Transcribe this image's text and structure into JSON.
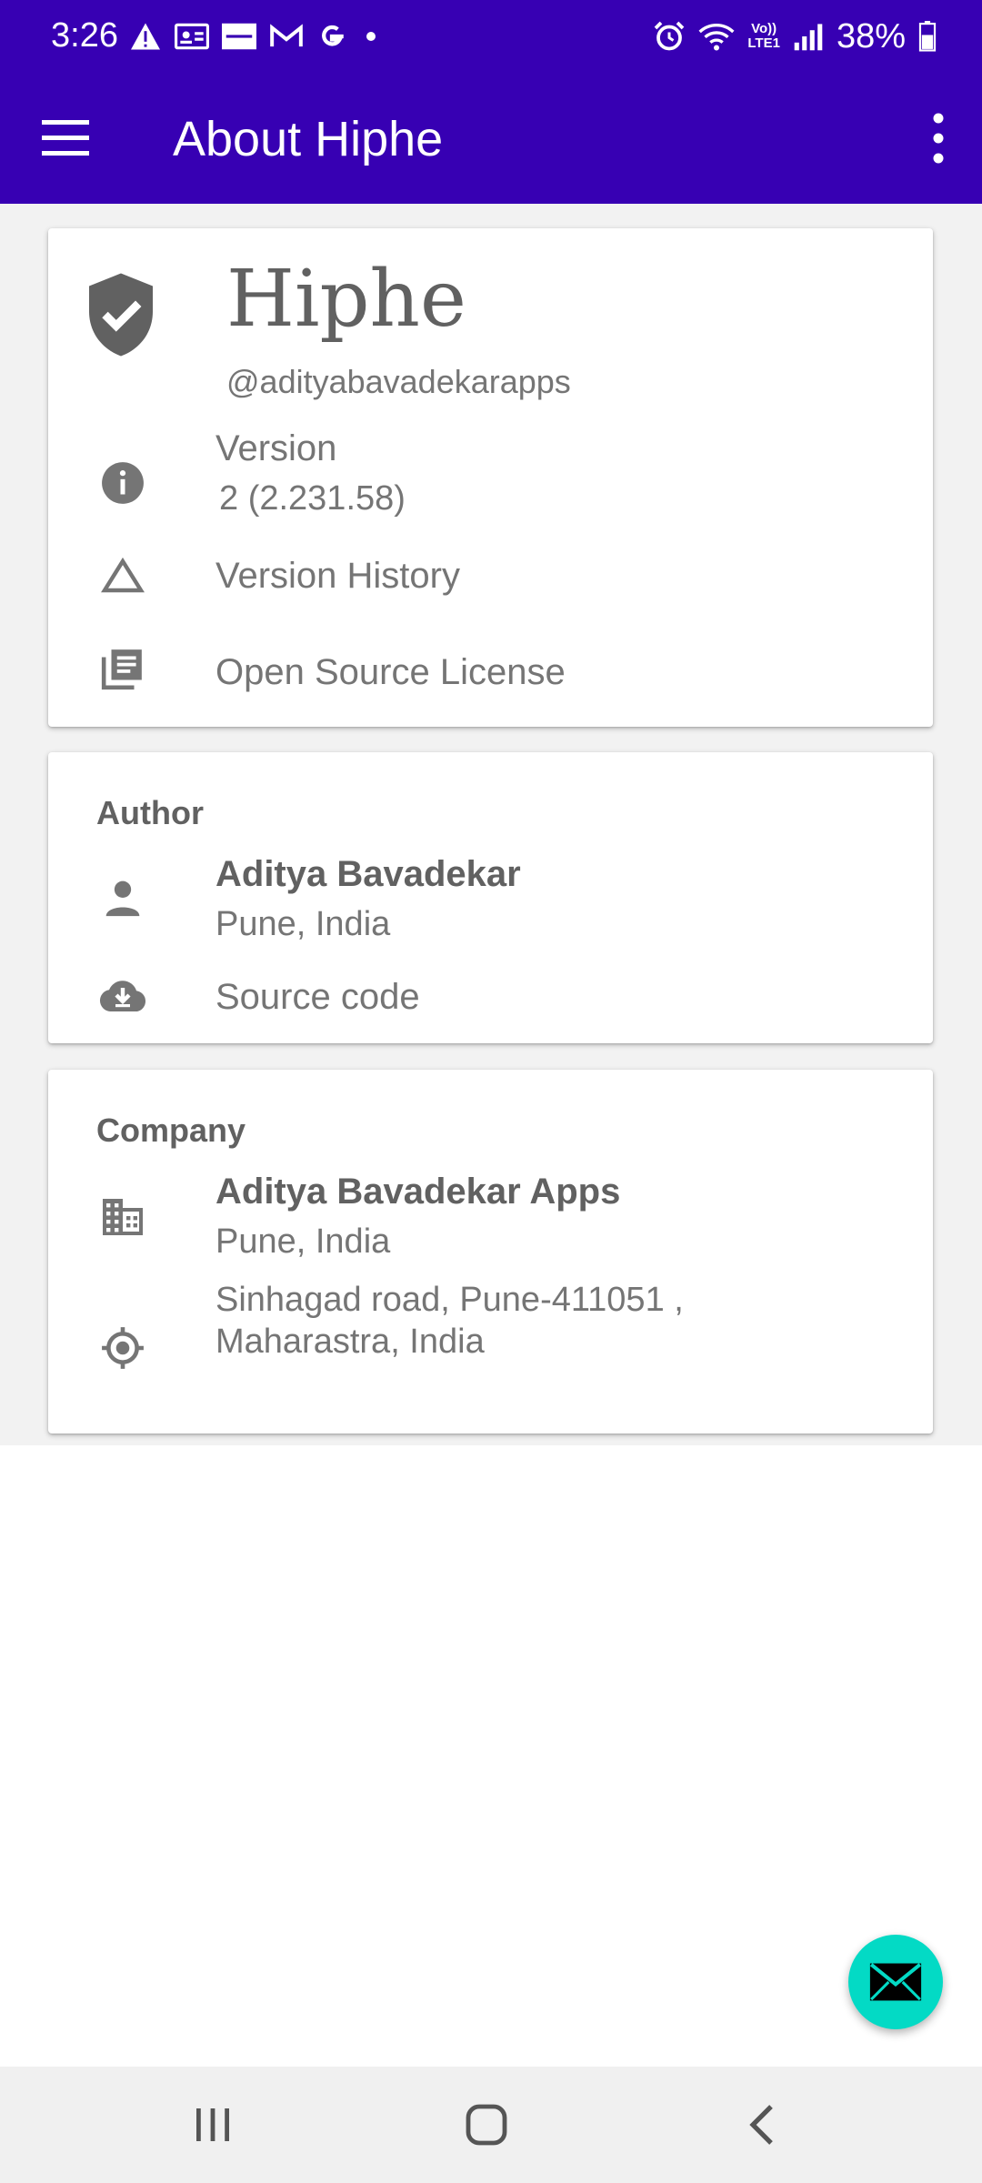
{
  "status_bar": {
    "time": "3:26",
    "battery": "38%",
    "left_icons": [
      "warning-icon",
      "id-card-icon",
      "zomato-icon",
      "gmail-icon",
      "google-icon",
      "dot-icon"
    ],
    "right_icons": [
      "alarm-icon",
      "wifi-icon",
      "volte-icon",
      "signal-icon",
      "battery-icon"
    ],
    "volte_label": "Vo))\nLTE1"
  },
  "app_bar": {
    "title": "About Hiphe",
    "color": "#3700b3"
  },
  "app_card": {
    "app_name": "Hiphe",
    "handle": "@adityabavadekarapps",
    "version_label": "Version",
    "version_value": "2 (2.231.58)",
    "version_history_label": "Version History",
    "license_label": "Open Source License"
  },
  "author_card": {
    "section_title": "Author",
    "name": "Aditya Bavadekar",
    "location": "Pune, India",
    "source_label": "Source code"
  },
  "company_card": {
    "section_title": "Company",
    "name": "Aditya Bavadekar Apps",
    "location": "Pune, India",
    "address_line1": "Sinhagad road, Pune-411051 ,",
    "address_line2": "Maharastra, India"
  },
  "fab": {
    "icon": "mail-icon",
    "color": "#03dac5"
  },
  "nav_bar": {
    "buttons": [
      "recents-button",
      "home-button",
      "back-button"
    ]
  }
}
